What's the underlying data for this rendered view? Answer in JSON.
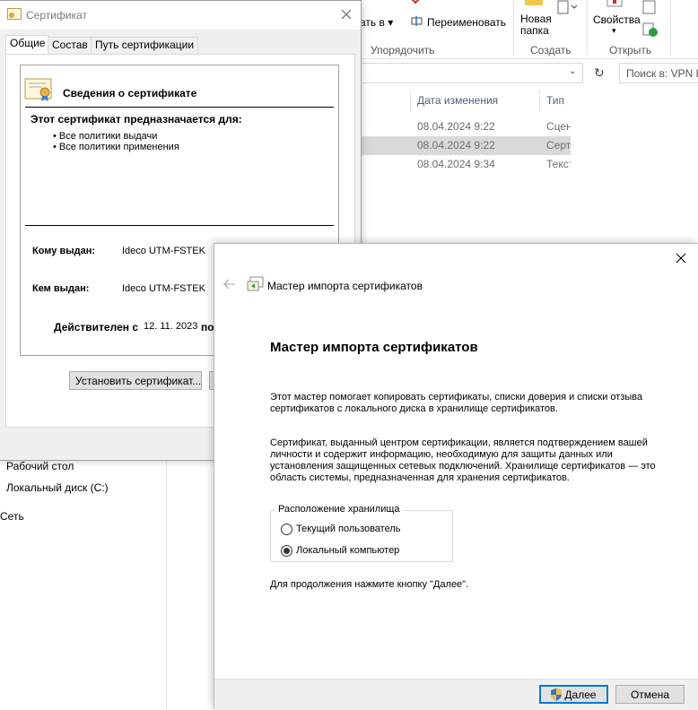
{
  "explorer": {
    "ribbon": {
      "move_to": "ать в",
      "rename": "Переименовать",
      "new_folder_line1": "Новая",
      "new_folder_line2": "папка",
      "properties": "Свойства",
      "group_organize": "Упорядочить",
      "group_create": "Создать",
      "group_open": "Открыть"
    },
    "search_placeholder": "Поиск в: VPN Н",
    "columns": {
      "date": "Дата изменения",
      "type": "Тип"
    },
    "files": [
      {
        "date": "08.04.2024 9:22",
        "type": "Сцен"
      },
      {
        "date": "08.04.2024 9:22",
        "type": "Серт"
      },
      {
        "date": "08.04.2024 9:34",
        "type": "Текст"
      }
    ],
    "nav": {
      "desktop": "Рабочий стол",
      "local_disk": "Локальный диск (C:)",
      "network": "Сеть"
    }
  },
  "cert_dialog": {
    "title": "Сертификат",
    "tabs": [
      "Общие",
      "Состав",
      "Путь сертификации"
    ],
    "heading": "Сведения о сертификате",
    "purpose_title": "Этот сертификат предназначается для:",
    "purposes": [
      "• Все политики выдачи",
      "• Все политики применения"
    ],
    "issued_to_label": "Кому выдан:",
    "issued_to_value": "Ideco UTM-FSTEK",
    "issued_by_label": "Кем выдан:",
    "issued_by_value": "Ideco UTM-FSTEK",
    "valid_from_label": "Действителен с",
    "valid_from_value": "12. 11. 2023",
    "valid_to_fragment": "по",
    "install_button": "Установить сертификат..."
  },
  "wizard": {
    "header_title": "Мастер импорта сертификатов",
    "heading": "Мастер импорта сертификатов",
    "intro": "Этот мастер помогает копировать сертификаты, списки доверия и списки отзыва сертификатов с локального диска в хранилище сертификатов.",
    "description": "Сертификат, выданный центром сертификации, является подтверждением вашей личности и содержит информацию, необходимую для защиты данных или установления защищенных сетевых подключений. Хранилище сертификатов — это область системы, предназначенная для хранения сертификатов.",
    "store_group_label": "Расположение хранилища",
    "options": [
      {
        "label": "Текущий пользователь",
        "selected": false
      },
      {
        "label": "Локальный компьютер",
        "selected": true
      }
    ],
    "continue_hint": "Для продолжения нажмите кнопку \"Далее\".",
    "next_button": "Далее",
    "cancel_button": "Отмена"
  },
  "colors": {
    "accent": "#0078d7",
    "dialog_bg": "#f0f0f0",
    "selection": "#d9d9d9"
  }
}
